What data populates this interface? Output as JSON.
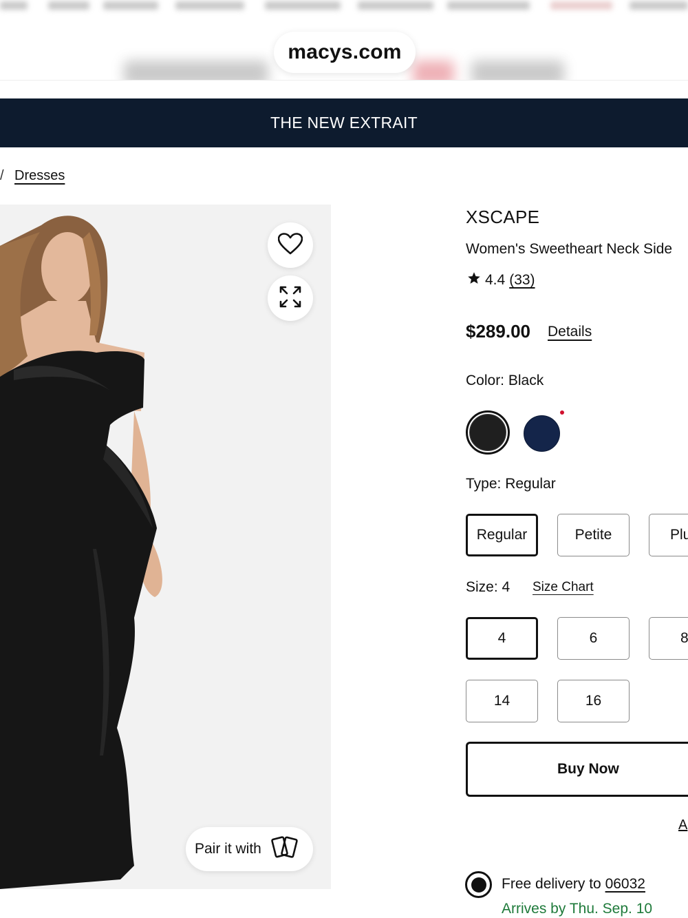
{
  "browser": {
    "url": "macys.com"
  },
  "banner": {
    "text": "THE NEW EXTRAIT"
  },
  "breadcrumb": {
    "separator": "/",
    "current": "Dresses"
  },
  "product_image": {
    "alt": "Woman wearing black off-the-shoulder ruffled gown",
    "pair_label": "Pair it with",
    "icons": [
      "heart-icon",
      "expand-icon",
      "cards-icon"
    ]
  },
  "product": {
    "brand": "XSCAPE",
    "name": "Women's Sweetheart Neck Side",
    "rating": "4.4",
    "review_count": "(33)",
    "price": "$289.00",
    "details_label": "Details"
  },
  "color": {
    "label": "Color: Black",
    "swatches": [
      {
        "name": "Black",
        "hex": "#1f1f1f",
        "selected": true
      },
      {
        "name": "Navy",
        "hex": "#14254a",
        "selected": false
      }
    ]
  },
  "type": {
    "label": "Type: Regular",
    "options": [
      "Regular",
      "Petite",
      "Plu"
    ]
  },
  "size": {
    "label": "Size: 4",
    "chart_label": "Size Chart",
    "row1": [
      "4",
      "6",
      "8"
    ],
    "row2": [
      "14",
      "16"
    ]
  },
  "buy_now_label": "Buy Now",
  "partial_link": "A",
  "delivery": {
    "prefix": "Free delivery to",
    "zip": "06032",
    "arrives": "Arrives by Thu. Sep. 10"
  }
}
